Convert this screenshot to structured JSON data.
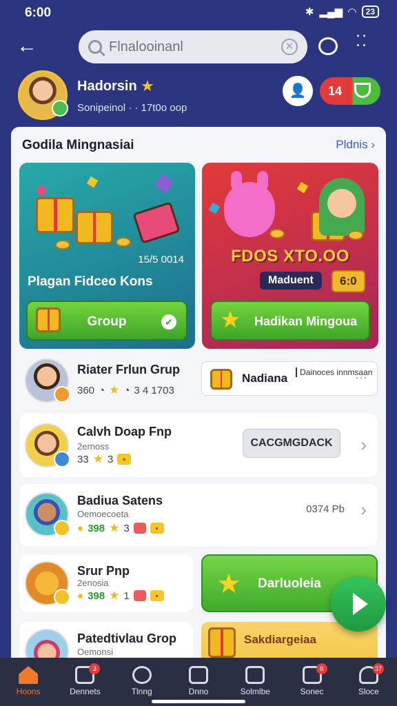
{
  "status": {
    "time": "6:00",
    "battery": "23"
  },
  "search": {
    "placeholder": "Flnalooinanl"
  },
  "profile": {
    "name": "Hadorsin",
    "subtitle": "Sonipeinol · · 17t0o oop",
    "toggle_value": "14"
  },
  "section": {
    "title": "Godila Mingnasiai",
    "more_label": "Pldnis"
  },
  "promo_left": {
    "number": "15/5 0014",
    "title": "Plagan Fidceo Kons",
    "button_label": "Group"
  },
  "promo_right": {
    "title": "FDOS XTO.OO",
    "tag": "Maduent",
    "value": "6:0",
    "button_label": "Hadikan Mingoua"
  },
  "rows": [
    {
      "title": "Riater Frlun Grup",
      "stat1": "360",
      "stat2": "3 4 1703"
    },
    {
      "title": "Calvh Doap Fnp",
      "subtitle": "2ernoss",
      "stat1": "33",
      "stat2": "3",
      "action": "CACGMGDACK"
    },
    {
      "title": "Badiua Satens",
      "subtitle": "Oemoecoeta",
      "stat1": "398",
      "stat2": "3",
      "size": "0374 Pb"
    },
    {
      "title": "Srur Pnp",
      "subtitle": "2enosia",
      "stat1": "398",
      "stat2": "1"
    },
    {
      "title": "Patedtivlau Grop",
      "subtitle": "Oemonsi"
    }
  ],
  "side_card": {
    "title": "Nadiana",
    "sub": "Dainoces innmsaan",
    "more": "···"
  },
  "big_button": {
    "label": "Darluoleia"
  },
  "yellow_card": {
    "label": "Sakdiargeiaa"
  },
  "nav": [
    {
      "label": "Hoons",
      "badge": ""
    },
    {
      "label": "Dennets",
      "badge": "3"
    },
    {
      "label": "Tlnng",
      "badge": ""
    },
    {
      "label": "Dnno",
      "badge": ""
    },
    {
      "label": "Solmlbe",
      "badge": ""
    },
    {
      "label": "Sonec",
      "badge": "8"
    },
    {
      "label": "Sloce",
      "badge": "37"
    }
  ],
  "colors": {
    "background": "#2b3580",
    "accent_green": "#4cbc3f",
    "accent_red": "#e33b3b",
    "link": "#3a5bd6"
  }
}
